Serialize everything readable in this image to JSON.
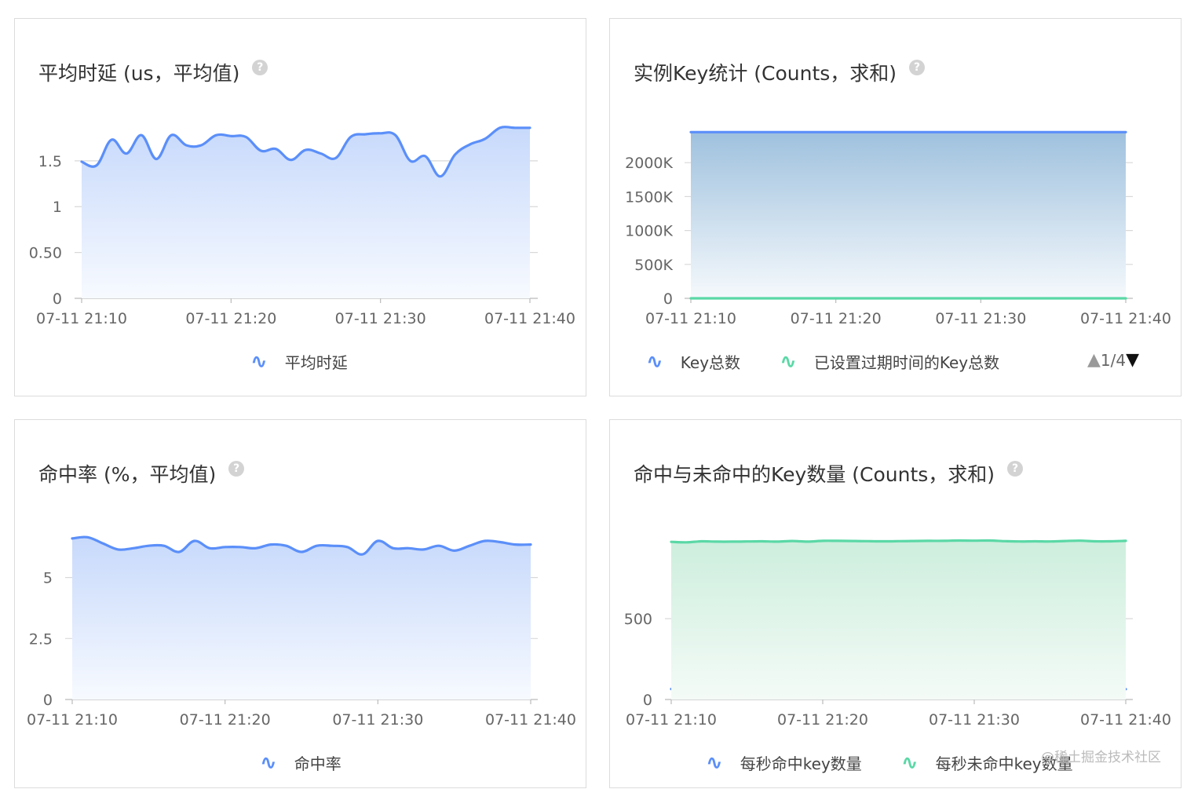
{
  "cards": [
    {
      "title": "平均时延 (us，平均值)",
      "help_icon": "question-circle-icon",
      "chart_data": {
        "type": "area",
        "x_tick_labels": [
          "07-11 21:10",
          "07-11 21:20",
          "07-11 21:30",
          "07-11 21:40"
        ],
        "y_tick_labels": [
          "0",
          "0.50",
          "1",
          "1.5"
        ],
        "y_tick_values": [
          0,
          0.5,
          1,
          1.5
        ],
        "ylim": [
          0,
          1.85
        ],
        "xlim": [
          0,
          30
        ],
        "grid": true,
        "series": [
          {
            "name": "平均时延",
            "color": "#5b8ff9",
            "x": [
              0,
              1,
              2,
              3,
              4,
              5,
              6,
              7,
              8,
              9,
              10,
              11,
              12,
              13,
              14,
              15,
              16,
              17,
              18,
              19,
              20,
              21,
              22,
              23,
              24,
              25,
              26,
              27,
              28,
              29,
              30
            ],
            "values": [
              1.49,
              1.45,
              1.73,
              1.58,
              1.78,
              1.52,
              1.78,
              1.67,
              1.67,
              1.78,
              1.77,
              1.76,
              1.61,
              1.63,
              1.51,
              1.62,
              1.58,
              1.53,
              1.76,
              1.79,
              1.8,
              1.78,
              1.5,
              1.55,
              1.33,
              1.57,
              1.68,
              1.74,
              1.86,
              1.86,
              1.86
            ]
          }
        ]
      }
    },
    {
      "title": "实例Key统计 (Counts，求和)",
      "help_icon": "question-circle-icon",
      "pager": {
        "text": "1/4",
        "up_icon": "triangle-up-icon",
        "down_icon": "triangle-down-icon"
      },
      "chart_data": {
        "type": "area",
        "x_tick_labels": [
          "07-11 21:10",
          "07-11 21:20",
          "07-11 21:30",
          "07-11 21:40"
        ],
        "y_tick_labels": [
          "0",
          "500K",
          "1000K",
          "1500K",
          "2000K"
        ],
        "y_tick_values": [
          0,
          500000,
          1000000,
          1500000,
          2000000
        ],
        "ylim": [
          0,
          2500000
        ],
        "xlim": [
          0,
          30
        ],
        "grid": true,
        "series": [
          {
            "name": "Key总数",
            "color": "#5b8ff9",
            "x": [
              0,
              30
            ],
            "values": [
              2450000,
              2450000
            ]
          },
          {
            "name": "已设置过期时间的Key总数",
            "color": "#5ad8a6",
            "x": [
              0,
              30
            ],
            "values": [
              0,
              0
            ]
          }
        ]
      }
    },
    {
      "title": "命中率 (%，平均值)",
      "help_icon": "question-circle-icon",
      "chart_data": {
        "type": "area",
        "x_tick_labels": [
          "07-11 21:10",
          "07-11 21:20",
          "07-11 21:30",
          "07-11 21:40"
        ],
        "y_tick_labels": [
          "0",
          "2.5",
          "5"
        ],
        "y_tick_values": [
          0,
          2.5,
          5
        ],
        "ylim": [
          0,
          6.95
        ],
        "xlim": [
          0,
          30
        ],
        "grid": true,
        "series": [
          {
            "name": "命中率",
            "color": "#5b8ff9",
            "x": [
              0,
              1,
              2,
              3,
              4,
              5,
              6,
              7,
              8,
              9,
              10,
              11,
              12,
              13,
              14,
              15,
              16,
              17,
              18,
              19,
              20,
              21,
              22,
              23,
              24,
              25,
              26,
              27,
              28,
              29,
              30
            ],
            "values": [
              6.6,
              6.65,
              6.4,
              6.15,
              6.2,
              6.3,
              6.3,
              6.05,
              6.5,
              6.2,
              6.25,
              6.25,
              6.2,
              6.35,
              6.3,
              6.05,
              6.3,
              6.3,
              6.25,
              5.95,
              6.5,
              6.2,
              6.2,
              6.15,
              6.3,
              6.1,
              6.3,
              6.5,
              6.45,
              6.35,
              6.35
            ]
          }
        ]
      }
    },
    {
      "title": "命中与未命中的Key数量 (Counts，求和)",
      "help_icon": "question-circle-icon",
      "chart_data": {
        "type": "area",
        "x_tick_labels": [
          "07-11 21:10",
          "07-11 21:20",
          "07-11 21:30",
          "07-11 21:40"
        ],
        "y_tick_labels": [
          "0",
          "500"
        ],
        "y_tick_values": [
          0,
          500
        ],
        "ylim": [
          0,
          1000
        ],
        "xlim": [
          0,
          30
        ],
        "grid": true,
        "series": [
          {
            "name": "每秒命中key数量",
            "color": "#5b8ff9",
            "x": [
              0,
              5,
              10,
              15,
              20,
              25,
              30
            ],
            "values": [
              65,
              62,
              63,
              60,
              63,
              62,
              64
            ]
          },
          {
            "name": "每秒未命中key数量",
            "color": "#5ad8a6",
            "x": [
              0,
              1,
              2,
              3,
              4,
              5,
              6,
              7,
              8,
              9,
              10,
              11,
              12,
              13,
              14,
              15,
              16,
              17,
              18,
              19,
              20,
              21,
              22,
              23,
              24,
              25,
              26,
              27,
              28,
              29,
              30
            ],
            "values": [
              975,
              972,
              978,
              976,
              976,
              977,
              978,
              976,
              980,
              976,
              981,
              981,
              980,
              979,
              978,
              979,
              980,
              981,
              981,
              983,
              982,
              983,
              979,
              977,
              978,
              977,
              980,
              982,
              978,
              978,
              981
            ]
          }
        ]
      }
    }
  ],
  "watermark": "@稀土掘金技术社区"
}
